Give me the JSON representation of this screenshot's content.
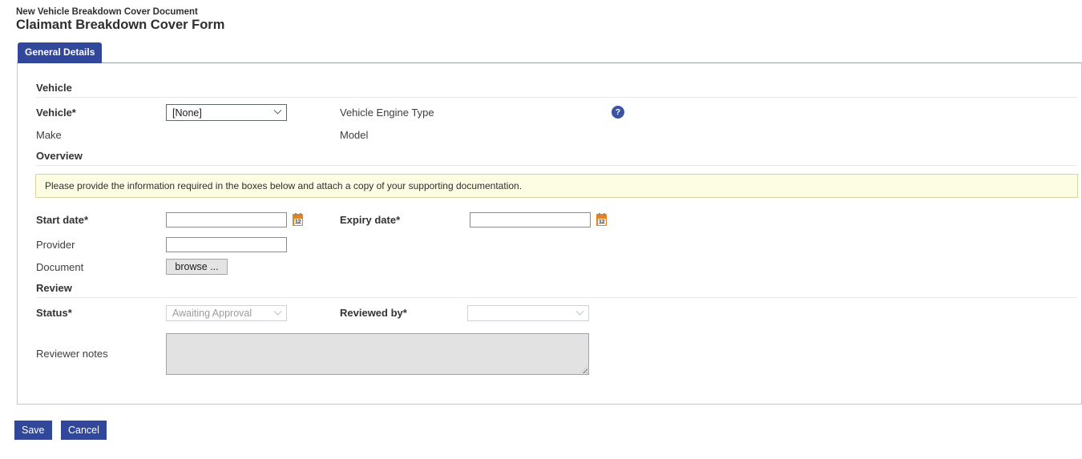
{
  "page": {
    "breadcrumb": "New Vehicle Breakdown Cover Document",
    "title": "Claimant Breakdown Cover Form"
  },
  "tab": {
    "label": "General Details",
    "active": true
  },
  "vehicle_section": {
    "heading": "Vehicle",
    "vehicle_label": "Vehicle*",
    "vehicle_selected": "[None]",
    "engine_type_label": "Vehicle Engine Type",
    "make_label": "Make",
    "model_label": "Model"
  },
  "overview_section": {
    "heading": "Overview",
    "info_message": "Please provide the information required in the boxes below and attach a copy of your supporting documentation.",
    "start_date_label": "Start date*",
    "start_date_value": "",
    "expiry_date_label": "Expiry date*",
    "expiry_date_value": "",
    "provider_label": "Provider",
    "provider_value": "",
    "document_label": "Document",
    "browse_button_label": "browse ..."
  },
  "review_section": {
    "heading": "Review",
    "status_label": "Status*",
    "status_selected": "Awaiting Approval",
    "status_disabled": true,
    "reviewed_by_label": "Reviewed by*",
    "reviewed_by_selected": "",
    "reviewed_by_disabled": true,
    "reviewer_notes_label": "Reviewer notes",
    "reviewer_notes_value": "",
    "reviewer_notes_disabled": true
  },
  "actions": {
    "save_label": "Save",
    "cancel_label": "Cancel"
  },
  "icons": {
    "help_icon_glyph": "?",
    "calendar_icon_day": "12"
  },
  "colors": {
    "accent_blue": "#31479B",
    "help_icon_blue": "#3A53A4",
    "info_bg": "#FDFDE3",
    "info_border": "#D8D3A0",
    "calendar_orange": "#E8821E",
    "disabled_field_bg": "#E2E2E2"
  }
}
